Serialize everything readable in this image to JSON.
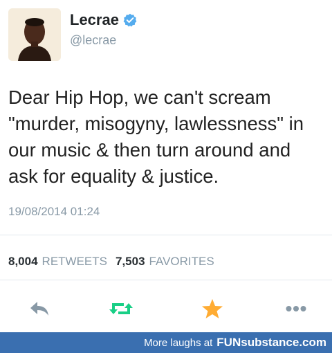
{
  "profile": {
    "display_name": "Lecrae",
    "handle": "@lecrae"
  },
  "tweet": {
    "text": "Dear Hip Hop, we can't scream \"murder, misogyny, lawlessness\" in our music & then turn around and ask for equality & justice.",
    "timestamp": "19/08/2014 01:24"
  },
  "stats": {
    "retweets_count": "8,004",
    "retweets_label": "RETWEETS",
    "favorites_count": "7,503",
    "favorites_label": "FAVORITES"
  },
  "actions": {
    "reply_icon": "reply-icon",
    "retweet_icon": "retweet-icon",
    "favorite_icon": "star-icon",
    "more_icon": "more-icon",
    "retweet_color": "#19cf86",
    "favorite_color": "#ffac33",
    "reply_color": "#8899a6"
  },
  "footer": {
    "prefix": "More laughs at",
    "brand": "FUNsubstance.com"
  },
  "colors": {
    "verified_badge": "#55acee",
    "footer_bg": "#3a6fb0"
  }
}
